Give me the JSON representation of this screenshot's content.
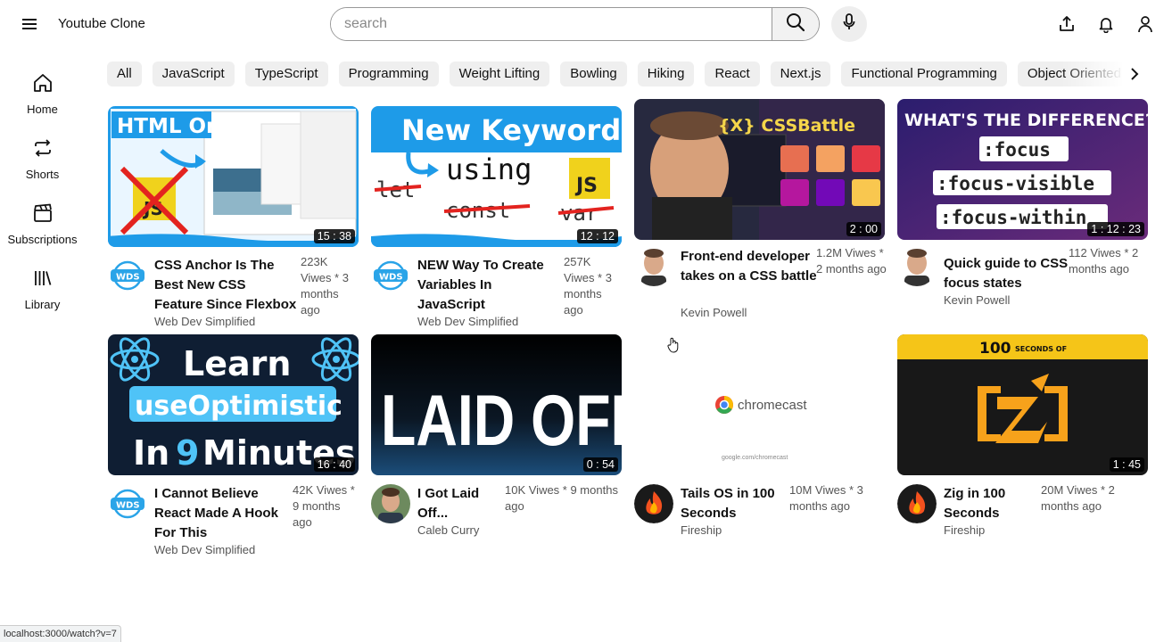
{
  "header": {
    "app_title": "Youtube Clone",
    "search_placeholder": "search",
    "icons": [
      "menu-icon",
      "search-icon",
      "mic-icon",
      "upload-icon",
      "bell-icon",
      "user-icon"
    ]
  },
  "sidebar": {
    "items": [
      {
        "label": "Home",
        "icon": "home-icon"
      },
      {
        "label": "Shorts",
        "icon": "repeat-icon"
      },
      {
        "label": "Subscriptions",
        "icon": "clapperboard-icon"
      },
      {
        "label": "Library",
        "icon": "library-icon"
      }
    ]
  },
  "chips": [
    "All",
    "JavaScript",
    "TypeScript",
    "Programming",
    "Weight Lifting",
    "Bowling",
    "Hiking",
    "React",
    "Next.js",
    "Functional Programming",
    "Object Oriented Programming"
  ],
  "videos": [
    {
      "title": "CSS Anchor Is The Best New CSS Feature Since Flexbox",
      "stats": "223K Viwes * 3 months ago",
      "channel": "Web Dev Simplified",
      "duration": "15 : 38",
      "thumb_text": [
        "HTML Only",
        "JS"
      ]
    },
    {
      "title": "NEW Way To Create Variables In JavaScript",
      "stats": "257K Viwes * 3 months ago",
      "channel": "Web Dev Simplified",
      "duration": "12 : 12",
      "thumb_text": [
        "New Keyword",
        "let",
        "using",
        "const",
        "JS",
        "var"
      ]
    },
    {
      "title": "Front-end developer takes on a CSS battle",
      "stats": "1.2M Viwes * 2 months ago",
      "channel": "Kevin Powell",
      "duration": "2 : 00",
      "thumb_text": [
        "{X} CSSBattle"
      ]
    },
    {
      "title": "Quick guide to CSS focus states",
      "stats": "112 Viwes * 2 months ago",
      "channel": "Kevin Powell",
      "duration": "1 : 12 : 23",
      "thumb_text": [
        "WHAT'S THE DIFFERENCE?",
        ":focus",
        ":focus-visible",
        ":focus-within"
      ]
    },
    {
      "title": "I Cannot Believe React Made A Hook For This",
      "stats": "42K Viwes * 9 months ago",
      "channel": "Web Dev Simplified",
      "duration": "16 : 40",
      "thumb_text": [
        "Learn",
        "useOptimistic",
        "In",
        "9",
        "Minutes"
      ]
    },
    {
      "title": "I Got Laid Off...",
      "stats": "10K Viwes * 9 months ago",
      "channel": "Caleb Curry",
      "duration": "0 : 54",
      "thumb_text": [
        "LAID OFF..."
      ]
    },
    {
      "title": "Tails OS in 100 Seconds",
      "stats": "10M Viwes * 3 months ago",
      "channel": "Fireship",
      "duration": "",
      "thumb_text": [
        "chromecast",
        "google.com/chromecast"
      ]
    },
    {
      "title": "Zig in 100 Seconds",
      "stats": "20M Viwes * 2 months ago",
      "channel": "Fireship",
      "duration": "1 : 45",
      "thumb_text": [
        "100",
        "SECONDS OF"
      ]
    }
  ],
  "status_url": "localhost:3000/watch?v=7",
  "colors": {
    "chip_bg": "#efefef",
    "wds_blue": "#2aa4e8",
    "fireship_red": "#d93025"
  }
}
